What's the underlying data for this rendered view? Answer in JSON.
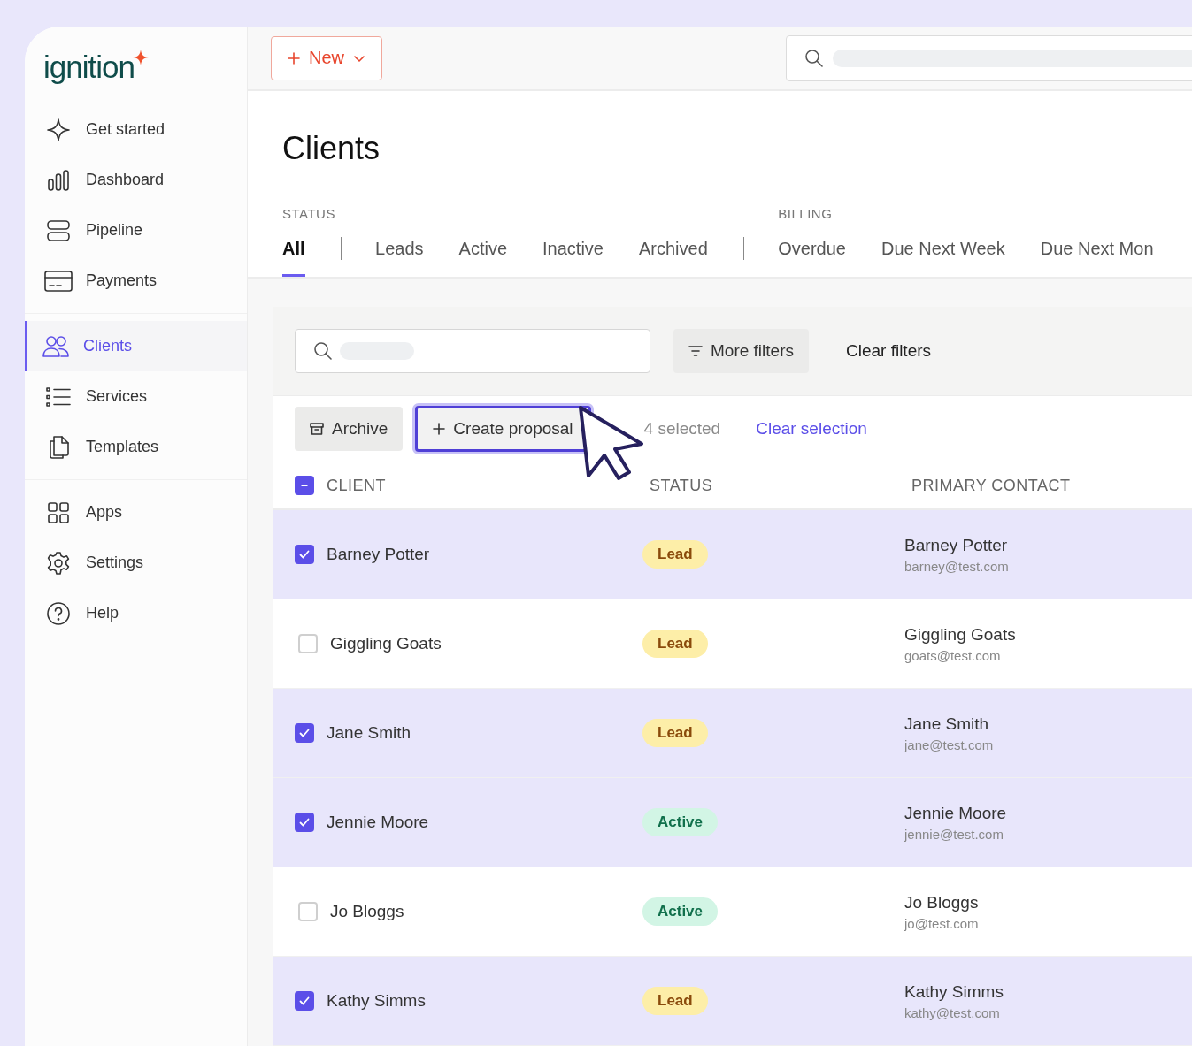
{
  "sidebar": {
    "logo": "ignition",
    "groups": [
      [
        {
          "label": "Get started",
          "selected": false
        },
        {
          "label": "Dashboard",
          "selected": false
        },
        {
          "label": "Pipeline",
          "selected": false
        },
        {
          "label": "Payments",
          "selected": false
        }
      ],
      [
        {
          "label": "Clients",
          "selected": true
        },
        {
          "label": "Services",
          "selected": false
        },
        {
          "label": "Templates",
          "selected": false
        }
      ],
      [
        {
          "label": "Apps",
          "selected": false
        },
        {
          "label": "Settings",
          "selected": false
        },
        {
          "label": "Help",
          "selected": false
        }
      ]
    ]
  },
  "topbar": {
    "new_button": "New"
  },
  "page": {
    "title": "Clients"
  },
  "filter_groups": [
    {
      "label": "STATUS",
      "tabs": [
        {
          "label": "All",
          "selected": true
        },
        {
          "label": "Leads",
          "selected": false
        },
        {
          "label": "Active",
          "selected": false
        },
        {
          "label": "Inactive",
          "selected": false
        },
        {
          "label": "Archived",
          "selected": false
        }
      ]
    },
    {
      "label": "BILLING",
      "tabs": [
        {
          "label": "Overdue",
          "selected": false
        },
        {
          "label": "Due Next Week",
          "selected": false
        },
        {
          "label": "Due Next Mon",
          "selected": false
        }
      ]
    }
  ],
  "filters": {
    "more_filters": "More filters",
    "clear_filters": "Clear filters"
  },
  "bulk_actions": {
    "buttons": [
      {
        "label": "Archive",
        "kind": "archive",
        "focused": false
      },
      {
        "label": "Create proposal",
        "kind": "add",
        "focused": true
      }
    ],
    "selected_count": "4 selected",
    "clear_selection": "Clear selection"
  },
  "table": {
    "select_all_partial": true,
    "columns": [
      "CLIENT",
      "STATUS",
      "PRIMARY CONTACT"
    ],
    "rows": [
      {
        "client": "Barney Potter",
        "selected": true,
        "status": {
          "label": "Lead",
          "kind": "lead"
        },
        "contact_name": "Barney Potter",
        "contact_email": "barney@test.com"
      },
      {
        "client": "Giggling Goats",
        "selected": false,
        "status": {
          "label": "Lead",
          "kind": "lead"
        },
        "contact_name": "Giggling Goats",
        "contact_email": "goats@test.com"
      },
      {
        "client": "Jane Smith",
        "selected": true,
        "status": {
          "label": "Lead",
          "kind": "lead"
        },
        "contact_name": "Jane Smith",
        "contact_email": "jane@test.com"
      },
      {
        "client": "Jennie Moore",
        "selected": true,
        "status": {
          "label": "Active",
          "kind": "active"
        },
        "contact_name": "Jennie Moore",
        "contact_email": "jennie@test.com"
      },
      {
        "client": "Jo Bloggs",
        "selected": false,
        "status": {
          "label": "Active",
          "kind": "active"
        },
        "contact_name": "Jo Bloggs",
        "contact_email": "jo@test.com"
      },
      {
        "client": "Kathy Simms",
        "selected": true,
        "status": {
          "label": "Lead",
          "kind": "lead"
        },
        "contact_name": "Kathy Simms",
        "contact_email": "kathy@test.com"
      }
    ]
  }
}
